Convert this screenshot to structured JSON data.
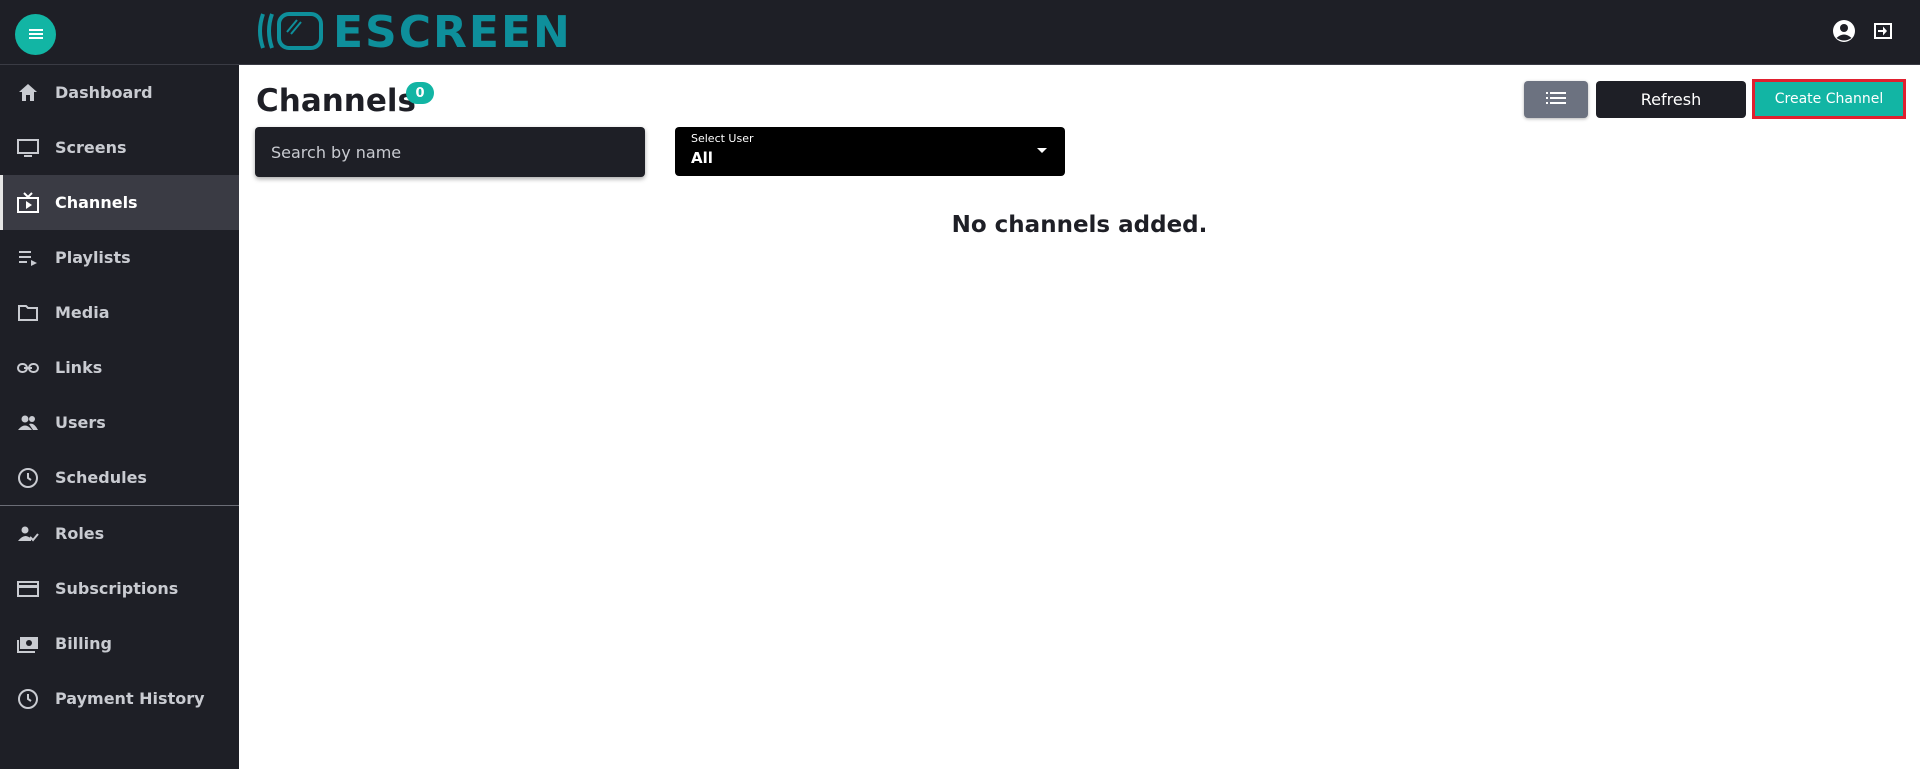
{
  "app": {
    "logo_text": "ESCREEN",
    "accent_color": "#12b5a4",
    "logo_color": "#0e8f9b"
  },
  "topbar": {
    "menu_icon": "hamburger-icon",
    "account_icon": "account-circle-icon",
    "logout_icon": "logout-icon"
  },
  "sidebar": {
    "items": [
      {
        "label": "Dashboard",
        "icon": "home-icon"
      },
      {
        "label": "Screens",
        "icon": "monitor-icon"
      },
      {
        "label": "Channels",
        "icon": "tv-icon",
        "active": true
      },
      {
        "label": "Playlists",
        "icon": "playlist-icon"
      },
      {
        "label": "Media",
        "icon": "folder-icon"
      },
      {
        "label": "Links",
        "icon": "link-icon"
      },
      {
        "label": "Users",
        "icon": "users-icon"
      },
      {
        "label": "Schedules",
        "icon": "clock-icon"
      },
      {
        "label": "Roles",
        "icon": "user-check-icon"
      },
      {
        "label": "Subscriptions",
        "icon": "credit-card-icon"
      },
      {
        "label": "Billing",
        "icon": "billing-icon"
      },
      {
        "label": "Payment History",
        "icon": "history-icon"
      }
    ]
  },
  "main": {
    "title": "Channels",
    "count": "0",
    "search": {
      "placeholder": "Search by name",
      "value": ""
    },
    "select_user": {
      "label": "Select User",
      "value": "All"
    },
    "toolbar": {
      "list_view_icon": "list-view-icon",
      "refresh_label": "Refresh",
      "create_label": "Create Channel"
    },
    "empty_message": "No channels added."
  }
}
